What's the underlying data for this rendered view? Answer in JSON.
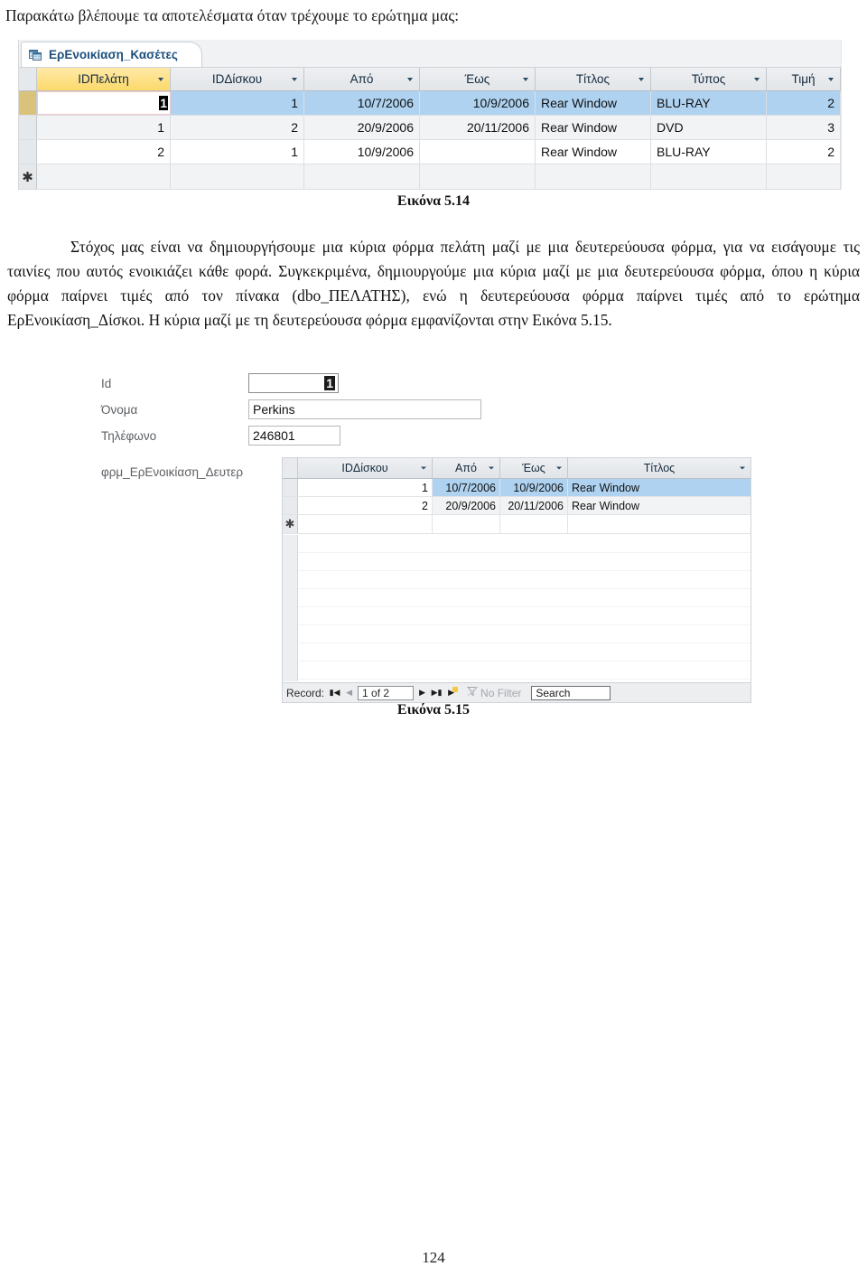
{
  "document": {
    "intro_text": "Παρακάτω βλέπουμε τα αποτελέσματα όταν τρέχουμε το ερώτημα μας:",
    "caption_514": "Εικόνα 5.14",
    "caption_515": "Εικόνα 5.15",
    "body_paragraph": "Στόχος μας είναι να δημιουργήσουμε μια κύρια φόρμα πελάτη μαζί με μια δευτερεύουσα φόρμα, για να εισάγουμε τις ταινίες που αυτός ενοικιάζει κάθε φορά. Συγκεκριμένα, δημιουργούμε μια κύρια μαζί με μια δευτερεύουσα φόρμα, όπου η κύρια φόρμα παίρνει τιμές από τον πίνακα (dbo_ΠΕΛΑΤΗΣ), ενώ η δευτερεύουσα φόρμα παίρνει τιμές από το ερώτημα  ΕρΕνοικίαση_Δίσκοι. Η κύρια μαζί με τη δευτερεύουσα φόρμα εμφανίζονται στην Εικόνα 5.15.",
    "page_number": "124"
  },
  "figure_514": {
    "tab": {
      "label": "ΕρΕνοικίαση_Κασέτες",
      "icon": "query-datasheet-icon"
    },
    "columns": [
      {
        "label": "IDΠελάτη",
        "active": true
      },
      {
        "label": "IDΔίσκου",
        "active": false
      },
      {
        "label": "Από",
        "active": false
      },
      {
        "label": "Έως",
        "active": false
      },
      {
        "label": "Τίτλος",
        "active": false
      },
      {
        "label": "Τύπος",
        "active": false
      },
      {
        "label": "Τιμή",
        "active": false
      }
    ],
    "rows": [
      {
        "selected": true,
        "editing_first_cell": true,
        "cells": [
          "1",
          "1",
          "10/7/2006",
          "10/9/2006",
          "Rear Window",
          "BLU-RAY",
          "2"
        ]
      },
      {
        "selected": false,
        "editing_first_cell": false,
        "cells": [
          "1",
          "2",
          "20/9/2006",
          "20/11/2006",
          "Rear Window",
          "DVD",
          "3"
        ]
      },
      {
        "selected": false,
        "editing_first_cell": false,
        "cells": [
          "2",
          "1",
          "10/9/2006",
          "",
          "Rear Window",
          "BLU-RAY",
          "2"
        ]
      }
    ],
    "new_record_marker": "✱"
  },
  "figure_515": {
    "fields": [
      {
        "label": "Id",
        "value": "1",
        "focused": true
      },
      {
        "label": "Όνομα",
        "value": "Perkins",
        "focused": false
      },
      {
        "label": "Τηλέφωνο",
        "value": "246801",
        "focused": false
      }
    ],
    "subform_label": "φρμ_ΕρΕνοικίαση_Δευτερ",
    "subform": {
      "columns": [
        {
          "label": "IDΔίσκου"
        },
        {
          "label": "Από"
        },
        {
          "label": "Έως"
        },
        {
          "label": "Τίτλος"
        }
      ],
      "rows": [
        {
          "selected": true,
          "cells": [
            "1",
            "10/7/2006",
            "10/9/2006",
            "Rear Window"
          ]
        },
        {
          "selected": false,
          "cells": [
            "2",
            "20/9/2006",
            "20/11/2006",
            "Rear Window"
          ]
        }
      ],
      "new_record_marker": "✱",
      "navigator": {
        "record_label": "Record:",
        "first_icon": "first-record-icon",
        "prev_icon": "previous-record-icon",
        "position": "1 of 2",
        "next_icon": "next-record-icon",
        "last_icon": "last-record-icon",
        "new_icon": "new-record-icon",
        "filter_status": "No Filter",
        "filter_icon": "filter-funnel-icon",
        "search_placeholder": "Search",
        "search_value": "Search"
      }
    }
  },
  "colors": {
    "accent_selection": "#aed2f0",
    "active_column_header": "#fcd96a",
    "tab_text": "#1d4f7c",
    "header_text": "#13293d",
    "label_grey": "#5c5f63"
  }
}
